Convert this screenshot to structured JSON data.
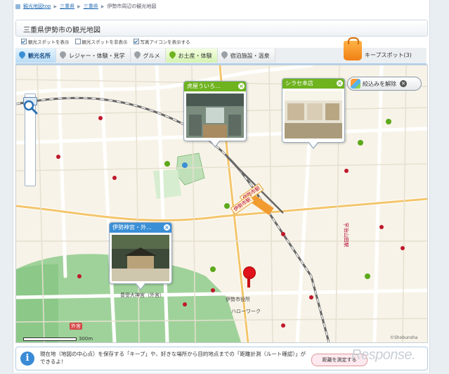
{
  "breadcrumb": {
    "items": [
      "観光地図top",
      "三重県",
      "三重県",
      "伊勢市周辺の観光地図"
    ]
  },
  "page_title": "三重県伊勢市の観光地図",
  "options": [
    {
      "label": "観光スポットを表示",
      "checked": true
    },
    {
      "label": "観光スポットを非表示",
      "checked": false
    },
    {
      "label": "写真アイコンを表示する",
      "checked": true
    }
  ],
  "tabs": [
    {
      "label": "観光名所",
      "active": true,
      "color": "#3b8fd6"
    },
    {
      "label": "レジャー・体験・見学",
      "active": false,
      "color": "#9aa0a6"
    },
    {
      "label": "グルメ",
      "active": false,
      "color": "#9aa0a6"
    },
    {
      "label": "お土産・体験",
      "active": false,
      "color": "#6fb31f"
    },
    {
      "label": "宿泊施設・温泉",
      "active": false,
      "color": "#9aa0a6"
    }
  ],
  "keep": {
    "label": "キープスポット(3)"
  },
  "map": {
    "filter_button": "絞込みを解除",
    "popups": [
      {
        "title": "虎屋ういろ…",
        "color": "green"
      },
      {
        "title": "シラセ本店",
        "color": "green"
      },
      {
        "title": "伊勢神宮・外…",
        "color": "blue"
      }
    ],
    "labels": {
      "station1": "伊勢市駅",
      "station2": "伊勢市駅",
      "cityhall": "伊勢市役所",
      "shrine": "豊受大神宮（外宮）",
      "geku": "外宮",
      "works": "ハローワーク",
      "ujiyamada": "宇治山田駅"
    },
    "scale": "300m",
    "copyright": "©Shobunsha"
  },
  "tip": {
    "text": "現在地（地図の中心点）を保存する「キープ」や、好きな場所から目的地点までの「距離計測（ルート確認）」ができるよ！",
    "measure_button": "距離を測定する"
  },
  "watermark": "Response."
}
